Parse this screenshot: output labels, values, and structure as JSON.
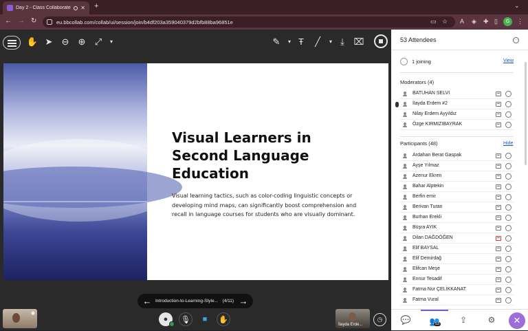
{
  "browser": {
    "tab_title": "Day 2 - Class Collaborate",
    "tab_close": "✕",
    "new_tab": "+",
    "url": "eu.bbcollab.com/collab/ui/session/join/b4df203a359040379d2bfb88ba96851e",
    "profile_initial": "G"
  },
  "slide": {
    "title": "Visual Learners in\nSecond Language\nEducation",
    "body": "Visual learning tactics, such as color-coding linguistic concepts or developing mind maps, can significantly boost comprehension and recall in language courses for students who are visually dominant."
  },
  "slide_nav": {
    "file_name": "Introduction-to-Learning-Style...",
    "page": "(4/11)"
  },
  "speaker_label": "İlayda Erde...",
  "attendees": {
    "title": "53 Attendees",
    "joining_text": "1 joining",
    "view_link": "View",
    "moderators_title": "Moderators (4)",
    "moderators": [
      "BATUHAN SELVI",
      "İlayda Erdem #2",
      "Nilay Erdem Ayyıldız",
      "Özge KIRMIZIBAYRAK"
    ],
    "participants_title": "Participants (48)",
    "hide_link": "Hide",
    "participants": [
      "Ardahan Berat Gaspak",
      "Ayşe Yılmaz",
      "Azenur Ekren",
      "Bahar Alptekin",
      "Berfin emir",
      "Berivan Turan",
      "Burhan Erekli",
      "Büşra AYIK",
      "Dilan DAĞDÖĞEN",
      "Elif BAYSAL",
      "Elif Demirdağ",
      "Elifcan Meşe",
      "Ennur Tesadif",
      "Fatma Nur ÇELİKKANAT",
      "Fatma Vural"
    ],
    "badge_count": "53"
  },
  "colors": {
    "accent": "#9b6ed8",
    "link": "#1a56c0",
    "browser_frame": "#5a3540"
  }
}
